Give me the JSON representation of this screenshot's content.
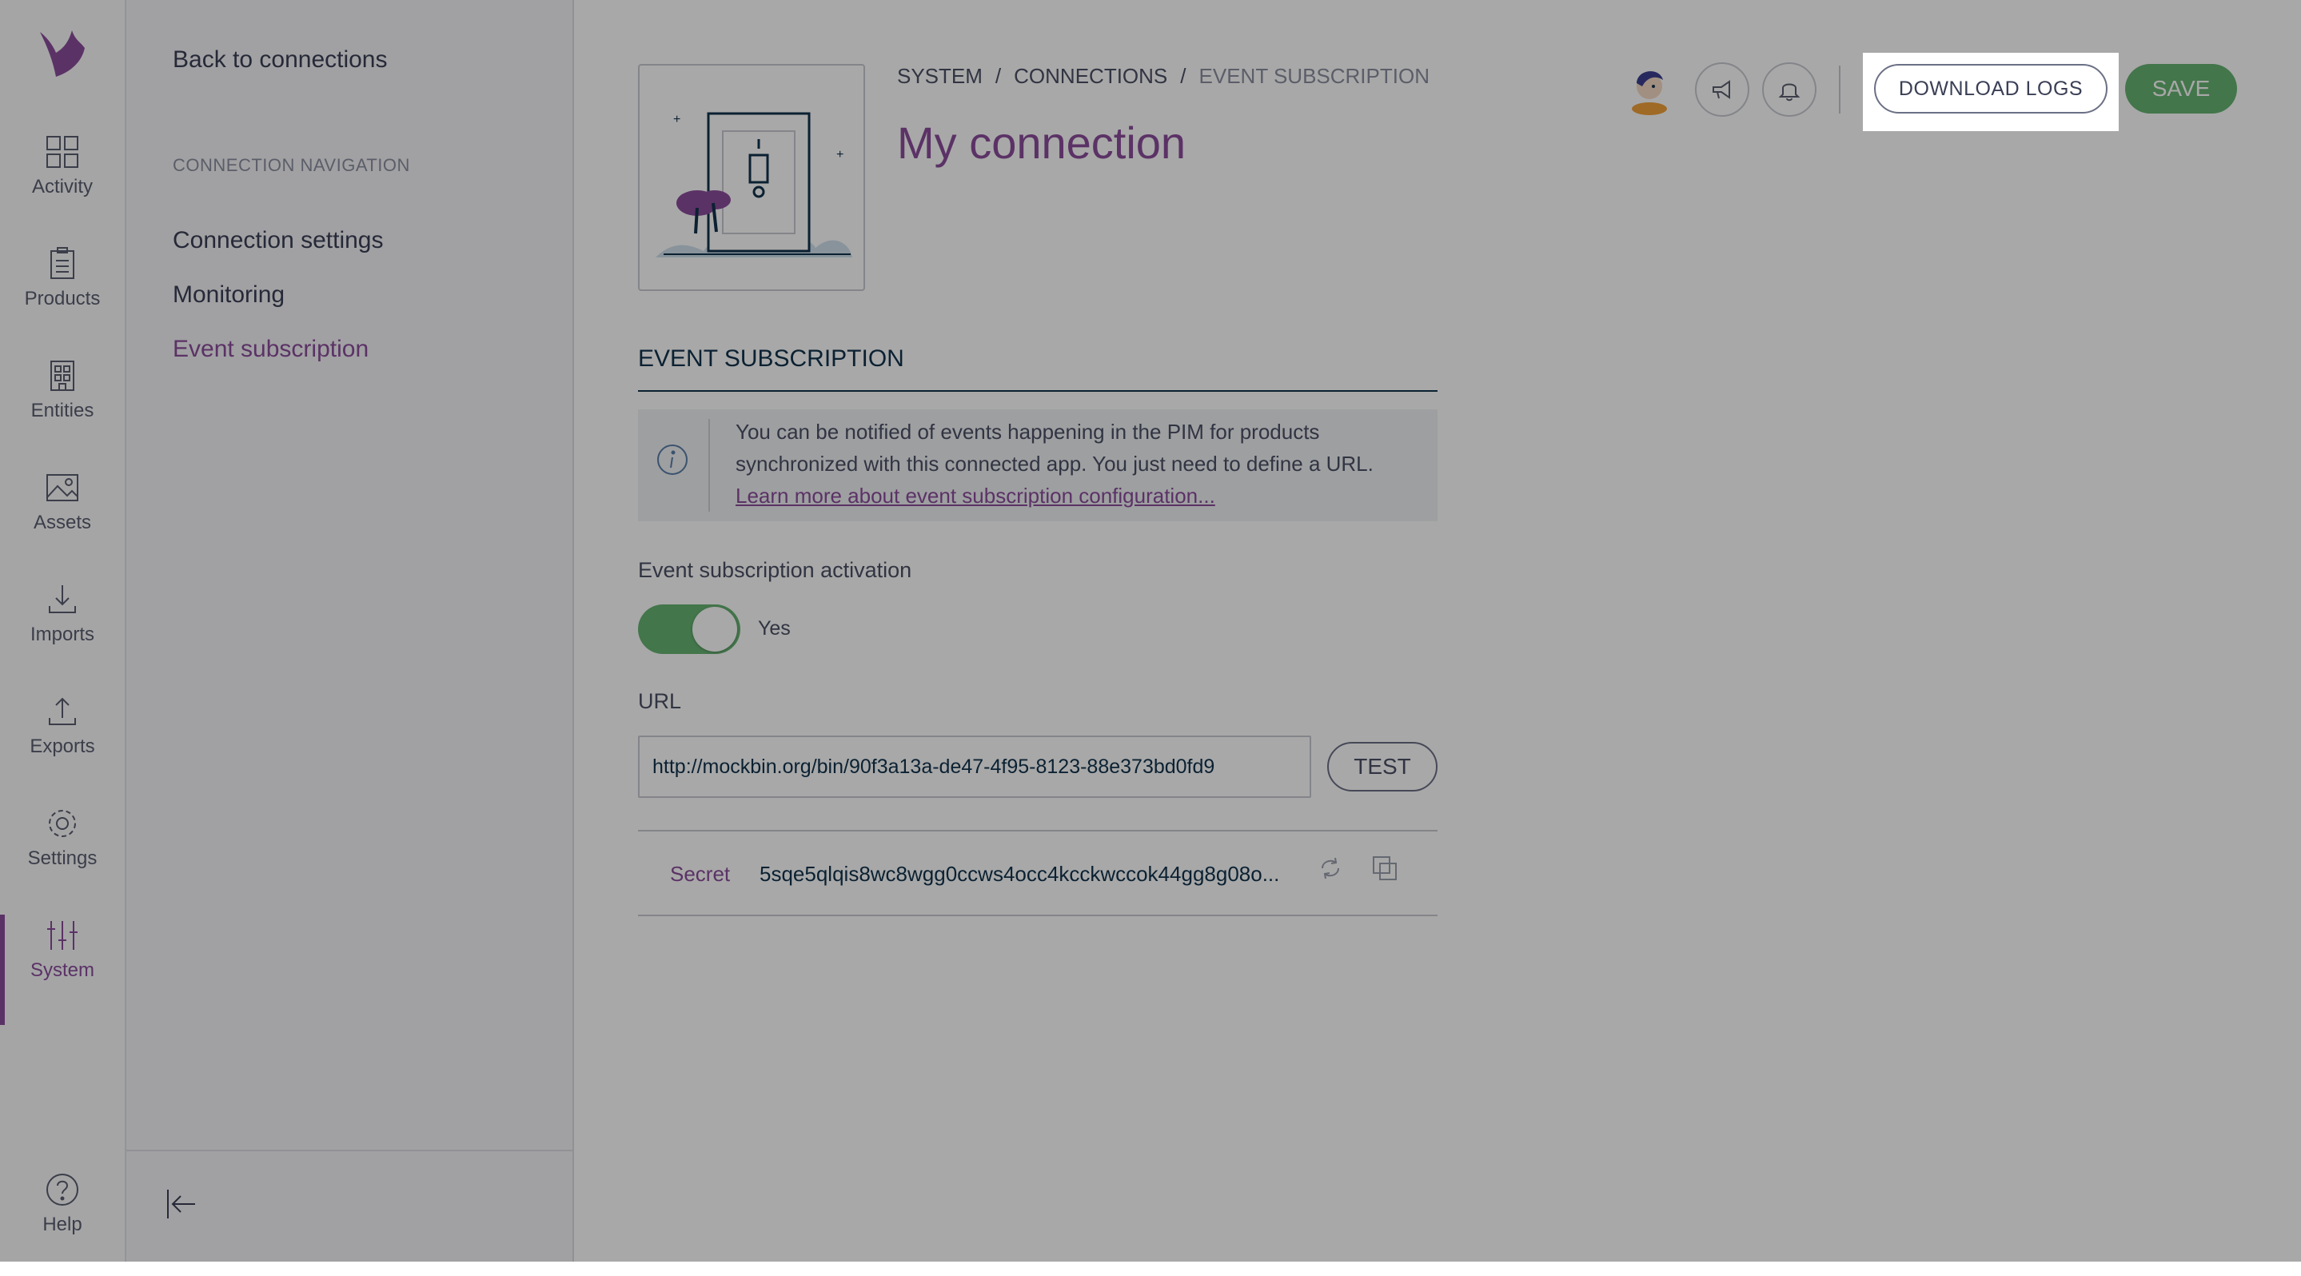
{
  "main_nav": {
    "items": [
      {
        "label": "Activity",
        "icon": "activity-icon"
      },
      {
        "label": "Products",
        "icon": "products-icon"
      },
      {
        "label": "Entities",
        "icon": "entities-icon"
      },
      {
        "label": "Assets",
        "icon": "assets-icon"
      },
      {
        "label": "Imports",
        "icon": "imports-icon"
      },
      {
        "label": "Exports",
        "icon": "exports-icon"
      },
      {
        "label": "Settings",
        "icon": "gear-icon"
      },
      {
        "label": "System",
        "icon": "system-icon"
      }
    ],
    "help": "Help",
    "active": "System"
  },
  "sub_nav": {
    "back": "Back to connections",
    "section_title": "CONNECTION NAVIGATION",
    "links": [
      "Connection settings",
      "Monitoring",
      "Event subscription"
    ],
    "active": "Event subscription"
  },
  "header": {
    "breadcrumb": [
      "SYSTEM",
      "CONNECTIONS",
      "EVENT SUBSCRIPTION"
    ],
    "separator": "/",
    "title": "My connection",
    "download_logs": "DOWNLOAD LOGS",
    "save": "SAVE"
  },
  "event_subscription": {
    "section_title": "EVENT SUBSCRIPTION",
    "info_text": "You can be notified of events happening in the PIM for products synchronized with this connected app. You just need to define a URL.",
    "info_link": "Learn more about event subscription configuration...",
    "activation_label": "Event subscription activation",
    "activation_value": "Yes",
    "url_label": "URL",
    "url_value": "http://mockbin.org/bin/90f3a13a-de47-4f95-8123-88e373bd0fd9",
    "test_button": "TEST",
    "secret_label": "Secret",
    "secret_value": "5sqe5qlqis8wc8wgg0ccws4occ4kcckwccok44gg8g08o..."
  },
  "colors": {
    "accent": "#8a4c9b",
    "success": "#67b373",
    "text": "#3a3f55"
  }
}
